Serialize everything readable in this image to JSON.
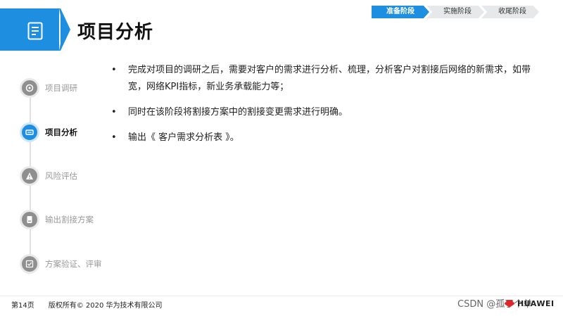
{
  "header": {
    "title": "项目分析"
  },
  "phases": [
    {
      "label": "准备阶段",
      "active": true
    },
    {
      "label": "实施阶段",
      "active": false
    },
    {
      "label": "收尾阶段",
      "active": false
    }
  ],
  "nav": {
    "items": [
      {
        "label": "项目调研",
        "icon": "survey-icon",
        "active": false
      },
      {
        "label": "项目分析",
        "icon": "analysis-icon",
        "active": true
      },
      {
        "label": "风险评估",
        "icon": "warning-icon",
        "active": false
      },
      {
        "label": "输出割接方案",
        "icon": "document-icon",
        "active": false
      },
      {
        "label": "方案验证、评审",
        "icon": "checklist-icon",
        "active": false
      }
    ]
  },
  "bullets": [
    "完成对项目的调研之后，需要对客户的需求进行分析、梳理，分析客户对割接后网络的新需求，如带宽，网络KPI指标，新业务承载能力等；",
    "同时在该阶段将割接方案中的割接变更需求进行明确。",
    "输出《 客户需求分析表 》。"
  ],
  "bullet_symbol": "•",
  "footer": {
    "page": "第14页",
    "copyright": "版权所有© 2020 华为技术有限公司",
    "watermark": "CSDN @孤了个单",
    "brand": "HUAWEI"
  },
  "colors": {
    "accent": "#1e8fe0",
    "inactive": "#8f8f8f",
    "brand_red": "#e0242b"
  }
}
